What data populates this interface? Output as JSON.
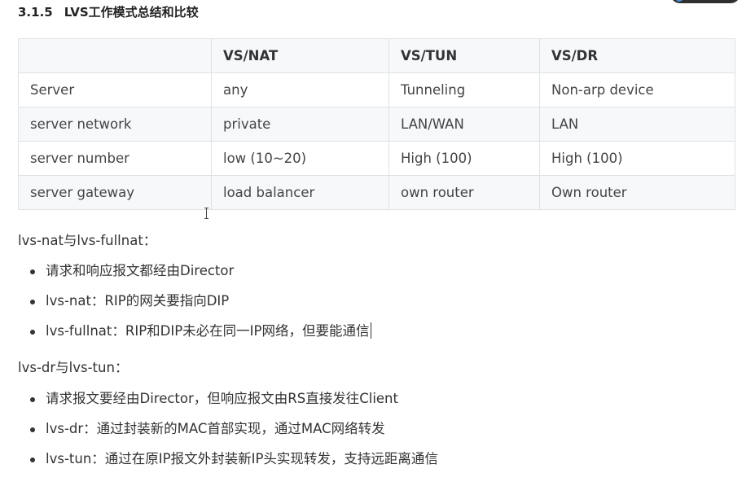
{
  "section": {
    "number": "3.1.5",
    "title": "LVS工作模式总结和比较"
  },
  "table": {
    "headers": [
      "",
      "VS/NAT",
      "VS/TUN",
      "VS/DR"
    ],
    "rows": [
      [
        "Server",
        "any",
        "Tunneling",
        "Non-arp device"
      ],
      [
        "server network",
        "private",
        "LAN/WAN",
        "LAN"
      ],
      [
        "server number",
        "low (10~20)",
        "High (100)",
        "High (100)"
      ],
      [
        "server gateway",
        "load balancer",
        "own router",
        "Own router"
      ]
    ]
  },
  "nat_section": {
    "intro": "lvs-nat与lvs-fullnat：",
    "items": [
      "请求和响应报文都经由Director",
      "lvs-nat：RIP的网关要指向DIP",
      "lvs-fullnat：RIP和DIP未必在同一IP网络，但要能通信"
    ]
  },
  "dr_section": {
    "intro": "lvs-dr与lvs-tun：",
    "items": [
      "请求报文要经由Director，但响应报文由RS直接发往Client",
      "lvs-dr：通过封装新的MAC首部实现，通过MAC网络转发",
      "lvs-tun：通过在原IP报文外封装新IP头实现转发，支持远距离通信"
    ]
  }
}
